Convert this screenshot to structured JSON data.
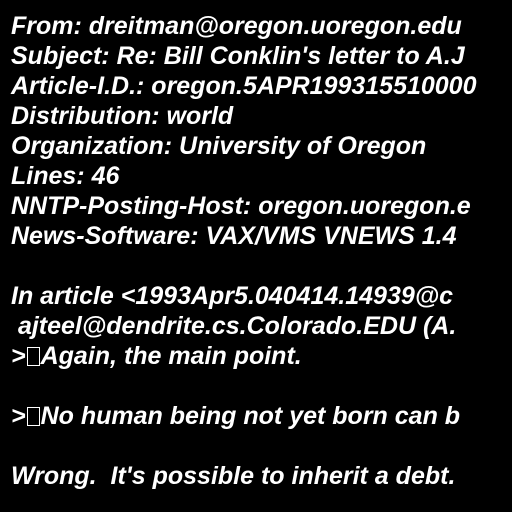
{
  "colors": {
    "background": "#000000",
    "text": "#ffffff"
  },
  "header": {
    "from": "From: dreitman@oregon.uoregon.edu",
    "subject": "Subject: Re: Bill Conklin's letter to A.J",
    "article_id": "Article-I.D.: oregon.5APR199315510000",
    "distribution": "Distribution: world",
    "organization": "Organization: University of Oregon",
    "lines": "Lines: 46",
    "nntp_host": "NNTP-Posting-Host: oregon.uoregon.e",
    "news_software": "News-Software: VAX/VMS VNEWS 1.4"
  },
  "body": {
    "attribution_1": "In article <1993Apr5.040414.14939@c",
    "attribution_2": " ajteel@dendrite.cs.Colorado.EDU (A.",
    "quote_1_prefix": ">",
    "quote_1_text": "Again, the main point.",
    "quote_2_prefix": ">",
    "quote_2_text": "No human being not yet born can b",
    "reply": "Wrong.  It's possible to inherit a debt."
  }
}
